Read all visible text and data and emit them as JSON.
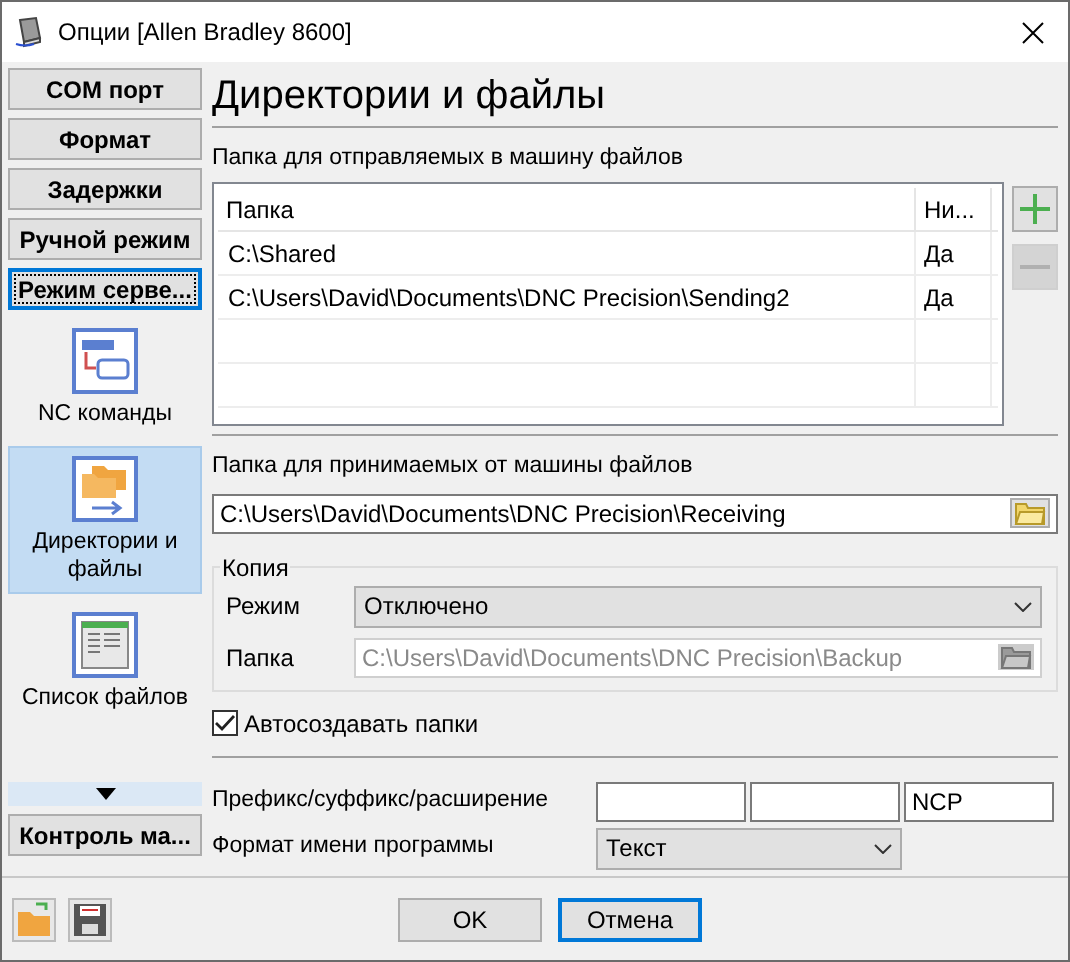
{
  "window": {
    "title": "Опции [Allen Bradley 8600]"
  },
  "sidebar": {
    "items": [
      {
        "kind": "button",
        "label": "COM порт",
        "focused": false
      },
      {
        "kind": "button",
        "label": "Формат",
        "focused": false
      },
      {
        "kind": "button",
        "label": "Задержки",
        "focused": false
      },
      {
        "kind": "button",
        "label": "Ручной режим",
        "focused": false
      },
      {
        "kind": "button",
        "label": "Режим серве...",
        "focused": true
      },
      {
        "kind": "nc",
        "label": "NC команды",
        "selected": false
      },
      {
        "kind": "folders",
        "label": "Директории и файлы",
        "selected": true
      },
      {
        "kind": "list",
        "label": "Список файлов",
        "selected": false
      }
    ],
    "bottom_items": [
      {
        "kind": "button",
        "label": "Контроль ма...",
        "focused": false
      }
    ]
  },
  "main": {
    "heading": "Директории и файлы",
    "send": {
      "label": "Папка для отправляемых в машину файлов",
      "columns": [
        "Папка",
        "Ни..."
      ],
      "rows": [
        [
          "C:\\Shared",
          "Да"
        ],
        [
          "C:\\Users\\David\\Documents\\DNC Precision\\Sending2",
          "Да"
        ]
      ],
      "add_disabled": false,
      "remove_disabled": true
    },
    "receive": {
      "label": "Папка для принимаемых от машины файлов",
      "value": "C:\\Users\\David\\Documents\\DNC Precision\\Receiving"
    },
    "copy": {
      "legend": "Копия",
      "mode_label": "Режим",
      "mode_value": "Отключено",
      "folder_label": "Папка",
      "folder_value": "C:\\Users\\David\\Documents\\DNC Precision\\Backup",
      "folder_disabled": true
    },
    "autocreate": {
      "label": "Автосоздавать папки",
      "checked": true
    },
    "affix": {
      "label": "Префикс/суффикс/расширение",
      "extension": "NCP"
    },
    "name_format": {
      "label": "Формат имени программы",
      "value": "Текст"
    }
  },
  "buttons": [
    {
      "label": "OK",
      "focused": false
    },
    {
      "label": "Отмена",
      "focused": true
    }
  ]
}
